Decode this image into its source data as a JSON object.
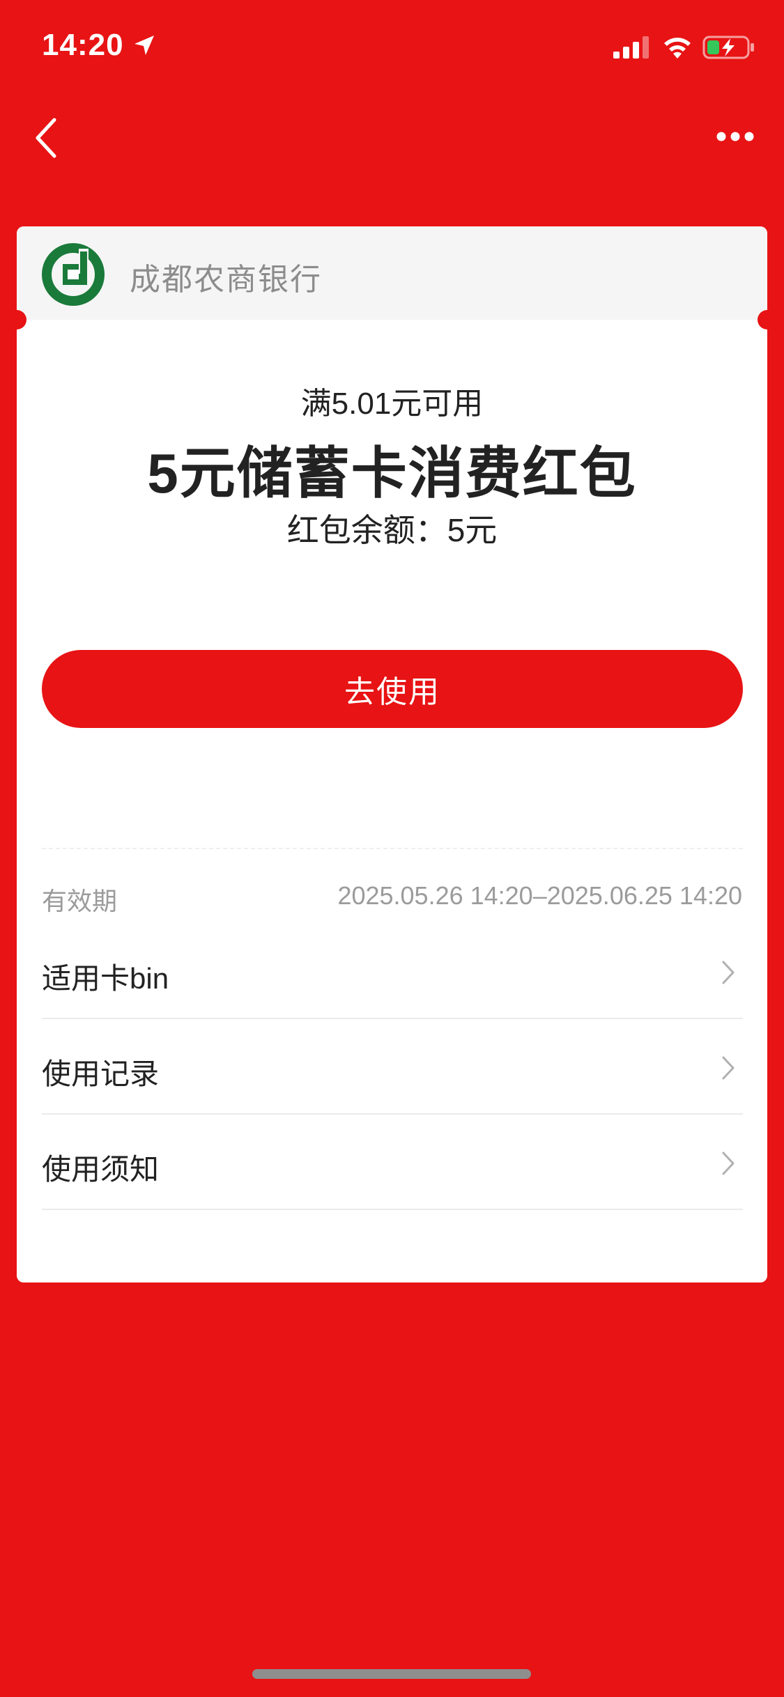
{
  "status_bar": {
    "time": "14:20",
    "icons": [
      "location-arrow-icon",
      "signal-icon",
      "wifi-icon",
      "battery-charging-icon"
    ]
  },
  "nav": {
    "back_icon": "chevron-left-icon",
    "more_icon": "more-dots-icon"
  },
  "card": {
    "bank_name": "成都农商银行",
    "threshold": "满5.01元可用",
    "title": "5元储蓄卡消费红包",
    "balance": "红包余额：5元",
    "use_button": "去使用",
    "validity_label": "有效期",
    "validity_value": "2025.05.26 14:20–2025.06.25 14:20",
    "rows": [
      {
        "label": "适用卡bin"
      },
      {
        "label": "使用记录"
      },
      {
        "label": "使用须知"
      }
    ]
  },
  "colors": {
    "brand_red": "#E81314",
    "bank_green": "#1A7A3A",
    "text_dark": "#222222",
    "text_gray": "#9B9B9B"
  }
}
